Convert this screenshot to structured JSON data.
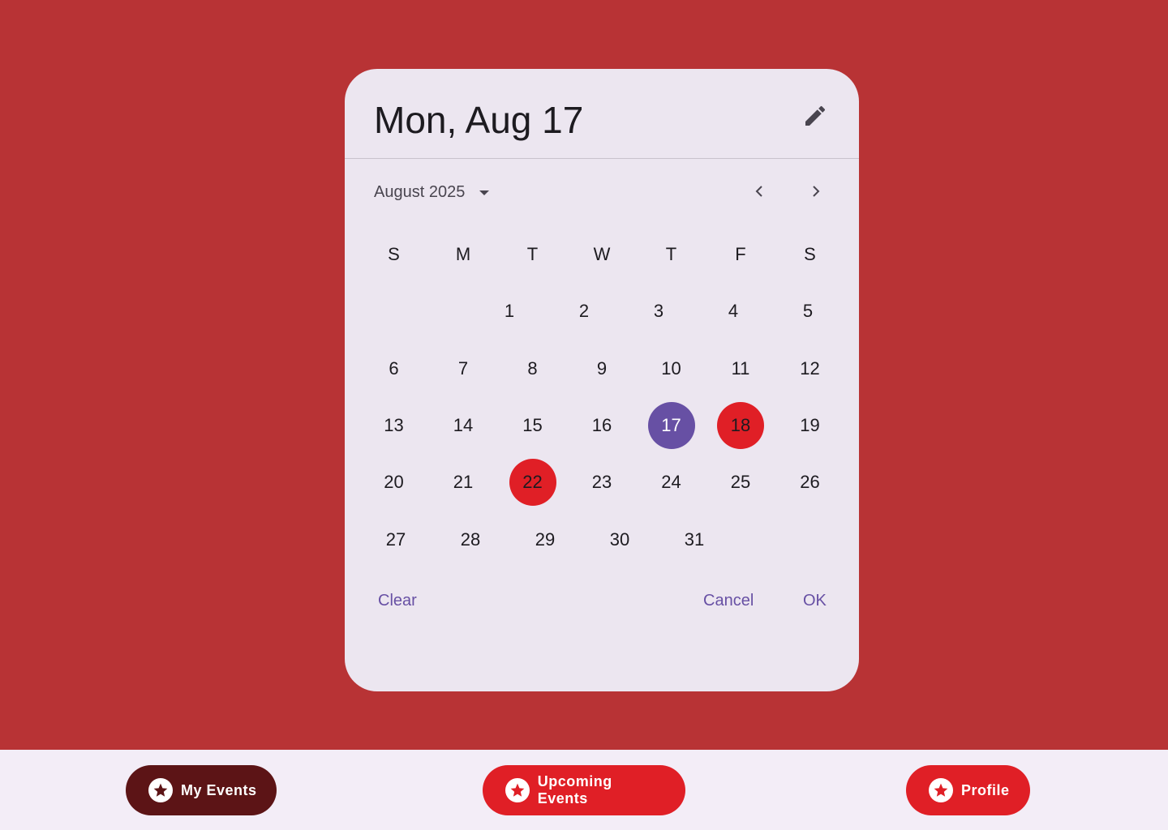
{
  "dialog": {
    "headline": "Mon, Aug 17",
    "month_label": "August 2025",
    "weekdays": [
      "S",
      "M",
      "T",
      "W",
      "T",
      "F",
      "S"
    ],
    "days": [
      "1",
      "2",
      "3",
      "4",
      "5",
      "6",
      "7",
      "8",
      "9",
      "10",
      "11",
      "12",
      "13",
      "14",
      "15",
      "16",
      "17",
      "18",
      "19",
      "20",
      "21",
      "22",
      "23",
      "24",
      "25",
      "26",
      "27",
      "28",
      "29",
      "30",
      "31"
    ],
    "selected_day": "17",
    "event_days": [
      "18",
      "22"
    ],
    "clear": "Clear",
    "cancel": "Cancel",
    "ok": "OK"
  },
  "nav": {
    "items": [
      {
        "label": "My Events",
        "active": true
      },
      {
        "label": "Upcoming Events"
      },
      {
        "label": "Profile"
      }
    ]
  },
  "colors": {
    "background": "#B83335",
    "surface": "#ECE6F0",
    "selected": "#6750A4",
    "event": "#E01F26",
    "active_nav": "#5C1416"
  }
}
